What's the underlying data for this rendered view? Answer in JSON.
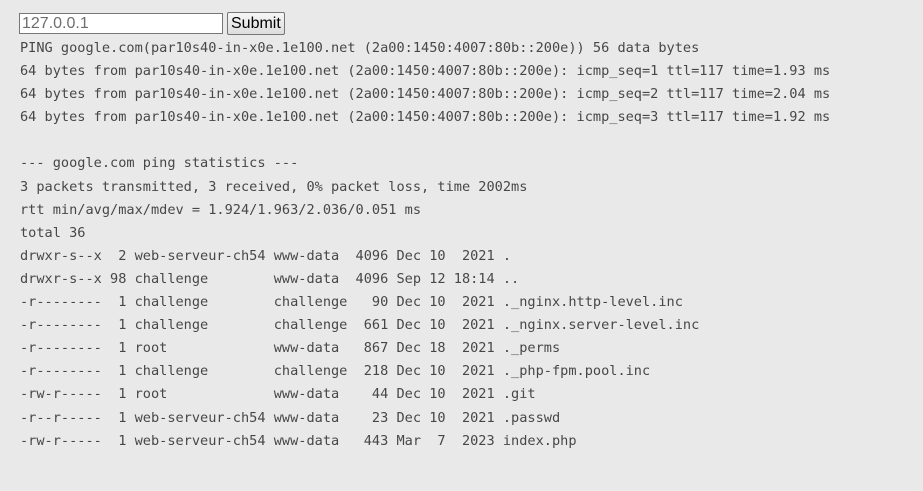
{
  "form": {
    "ip_value": "127.0.0.1",
    "submit_label": "Submit"
  },
  "output_lines": [
    "PING google.com(par10s40-in-x0e.1e100.net (2a00:1450:4007:80b::200e)) 56 data bytes",
    "64 bytes from par10s40-in-x0e.1e100.net (2a00:1450:4007:80b::200e): icmp_seq=1 ttl=117 time=1.93 ms",
    "64 bytes from par10s40-in-x0e.1e100.net (2a00:1450:4007:80b::200e): icmp_seq=2 ttl=117 time=2.04 ms",
    "64 bytes from par10s40-in-x0e.1e100.net (2a00:1450:4007:80b::200e): icmp_seq=3 ttl=117 time=1.92 ms",
    "",
    "--- google.com ping statistics ---",
    "3 packets transmitted, 3 received, 0% packet loss, time 2002ms",
    "rtt min/avg/max/mdev = 1.924/1.963/2.036/0.051 ms",
    "total 36",
    "drwxr-s--x  2 web-serveur-ch54 www-data  4096 Dec 10  2021 .",
    "drwxr-s--x 98 challenge        www-data  4096 Sep 12 18:14 ..",
    "-r--------  1 challenge        challenge   90 Dec 10  2021 ._nginx.http-level.inc",
    "-r--------  1 challenge        challenge  661 Dec 10  2021 ._nginx.server-level.inc",
    "-r--------  1 root             www-data   867 Dec 18  2021 ._perms",
    "-r--------  1 challenge        challenge  218 Dec 10  2021 ._php-fpm.pool.inc",
    "-rw-r-----  1 root             www-data    44 Dec 10  2021 .git",
    "-r--r-----  1 web-serveur-ch54 www-data    23 Dec 10  2021 .passwd",
    "-rw-r-----  1 web-serveur-ch54 www-data   443 Mar  7  2023 index.php"
  ]
}
